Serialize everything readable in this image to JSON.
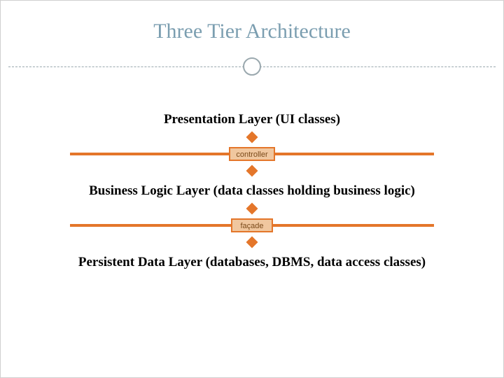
{
  "title": "Three Tier Architecture",
  "layers": {
    "presentation": "Presentation Layer (UI classes)",
    "business": "Business Logic Layer (data classes holding business logic)",
    "persistent": "Persistent Data Layer (databases, DBMS, data access classes)"
  },
  "connectors": {
    "controller": "controller",
    "facade": "façade"
  },
  "colors": {
    "accent": "#e4762a",
    "title": "#7b9eb0",
    "box_fill": "#f0c79f"
  }
}
